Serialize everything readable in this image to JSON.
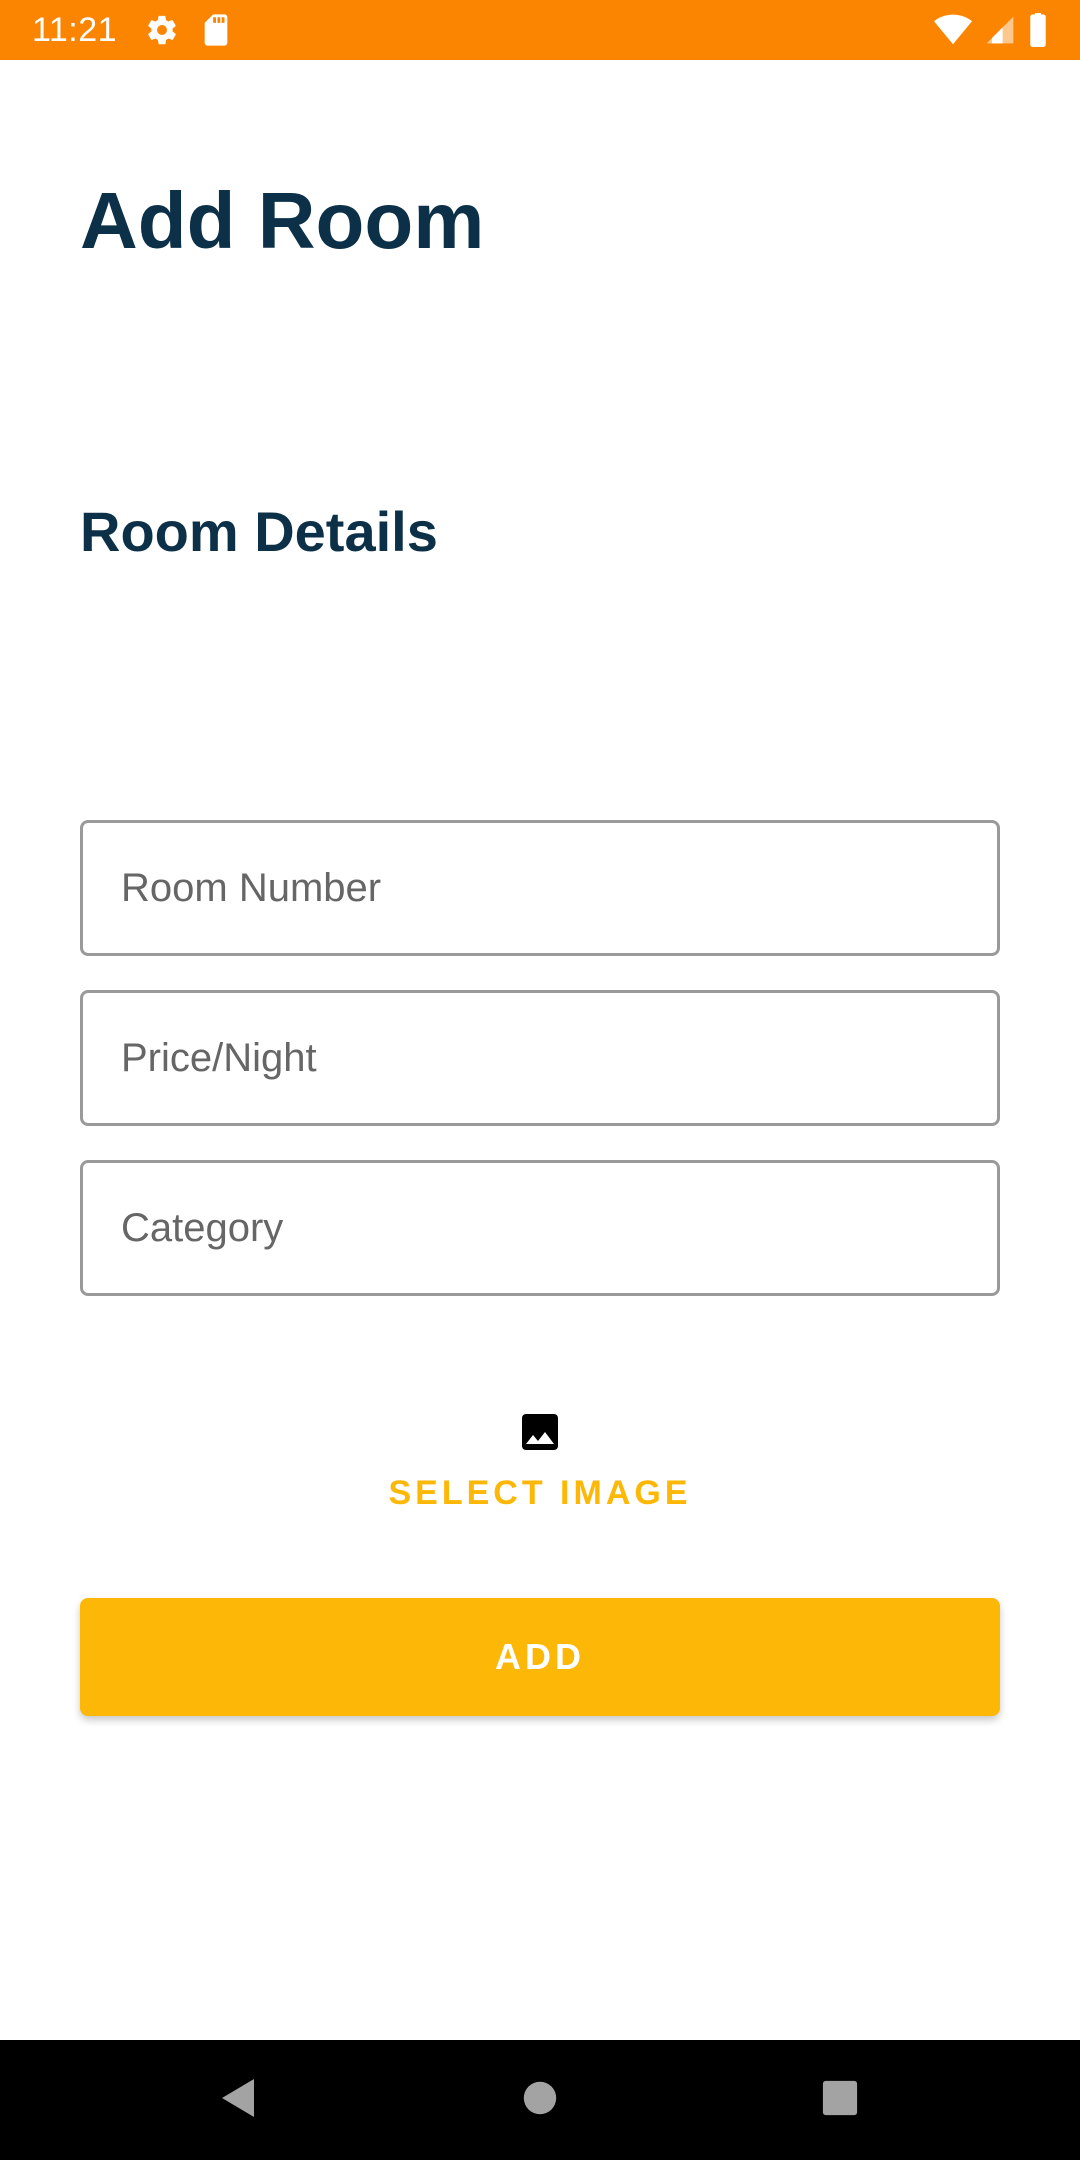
{
  "status_bar": {
    "time": "11:21",
    "background_color": "#fb8500",
    "left_icons": [
      "gear-icon",
      "sd-card-icon"
    ],
    "right_icons": [
      "wifi-icon",
      "cell-signal-icon",
      "battery-icon"
    ]
  },
  "page": {
    "title": "Add Room",
    "section_title": "Room Details",
    "title_color": "#0c3047"
  },
  "form": {
    "room_number": {
      "placeholder": "Room Number",
      "value": ""
    },
    "price_per_night": {
      "placeholder": "Price/Night",
      "value": ""
    },
    "category": {
      "placeholder": "Category",
      "value": ""
    }
  },
  "select_image": {
    "icon": "image-icon",
    "label": "SELECT IMAGE",
    "color": "#fdb706"
  },
  "add_button": {
    "label": "ADD",
    "color": "#fdb706"
  },
  "nav_bar": {
    "buttons": [
      "back-icon",
      "home-icon",
      "recents-icon"
    ]
  }
}
